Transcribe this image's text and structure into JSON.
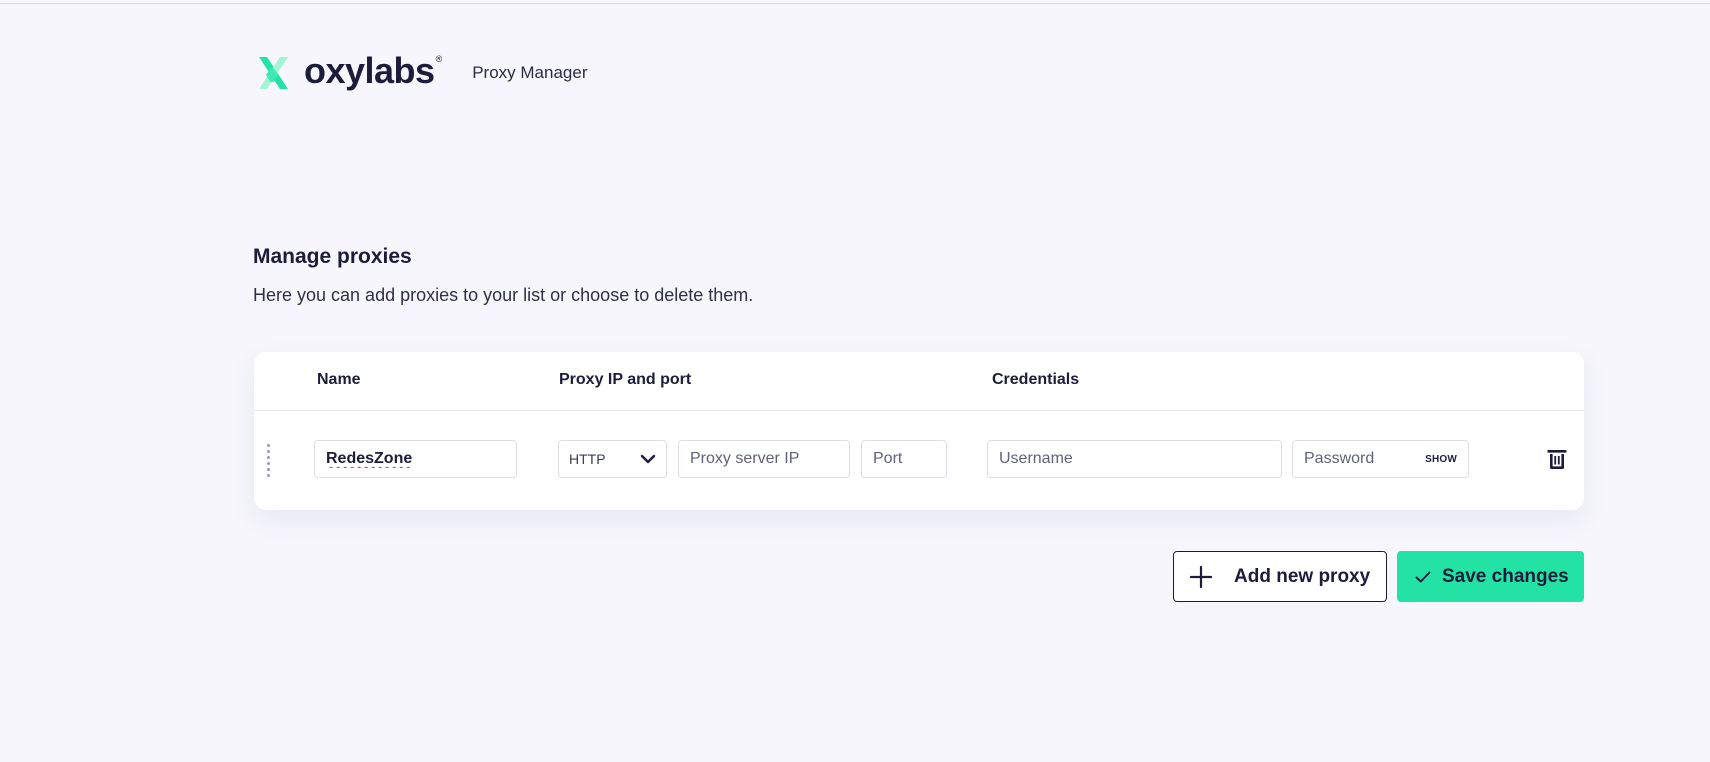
{
  "header": {
    "brand": "oxylabs",
    "brand_mark": "®",
    "product": "Proxy Manager"
  },
  "section": {
    "title": "Manage proxies",
    "description": "Here you can add proxies to your list or choose to delete them."
  },
  "table": {
    "columns": {
      "name": "Name",
      "proxy": "Proxy IP and port",
      "credentials": "Credentials"
    },
    "rows": [
      {
        "name": "RedesZone",
        "protocol": "HTTP",
        "ip_placeholder": "Proxy server IP",
        "port_placeholder": "Port",
        "username_placeholder": "Username",
        "password_placeholder": "Password",
        "show_label": "SHOW"
      }
    ]
  },
  "actions": {
    "add_label": "Add new proxy",
    "save_label": "Save changes"
  },
  "colors": {
    "accent": "#23e3a4",
    "text": "#1b1d3b",
    "background": "#f6f6fc"
  },
  "icons": [
    "oxylabs-logo-icon",
    "drag-handle-icon",
    "chevron-down-icon",
    "trash-icon",
    "plus-icon",
    "check-icon"
  ]
}
